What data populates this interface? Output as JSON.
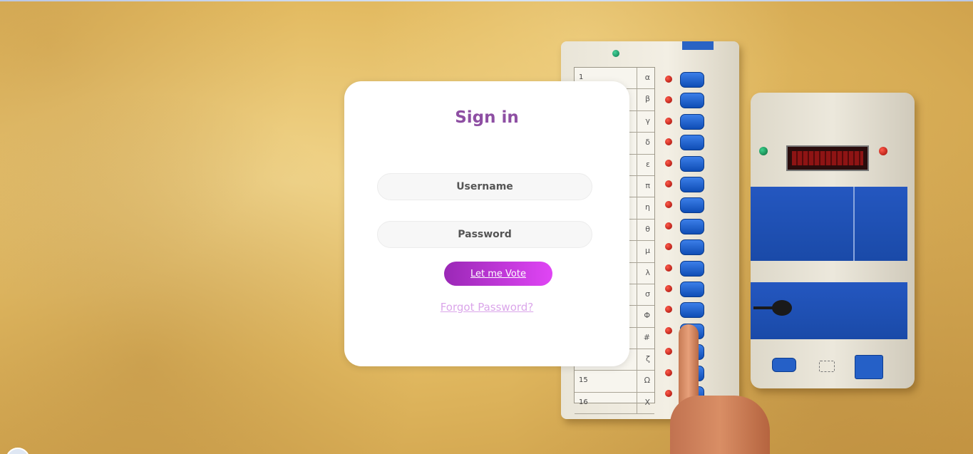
{
  "login": {
    "title": "Sign in",
    "username_placeholder": "Username",
    "password_placeholder": "Password",
    "submit_label": "Let me Vote",
    "forgot_password_label": "Forgot Password?"
  },
  "colors": {
    "title": "#8e4fa3",
    "button_start": "#9a28b6",
    "button_end": "#e045f5",
    "forgot_link": "#dba6ea",
    "evm_blue": "#1a4aa8"
  }
}
